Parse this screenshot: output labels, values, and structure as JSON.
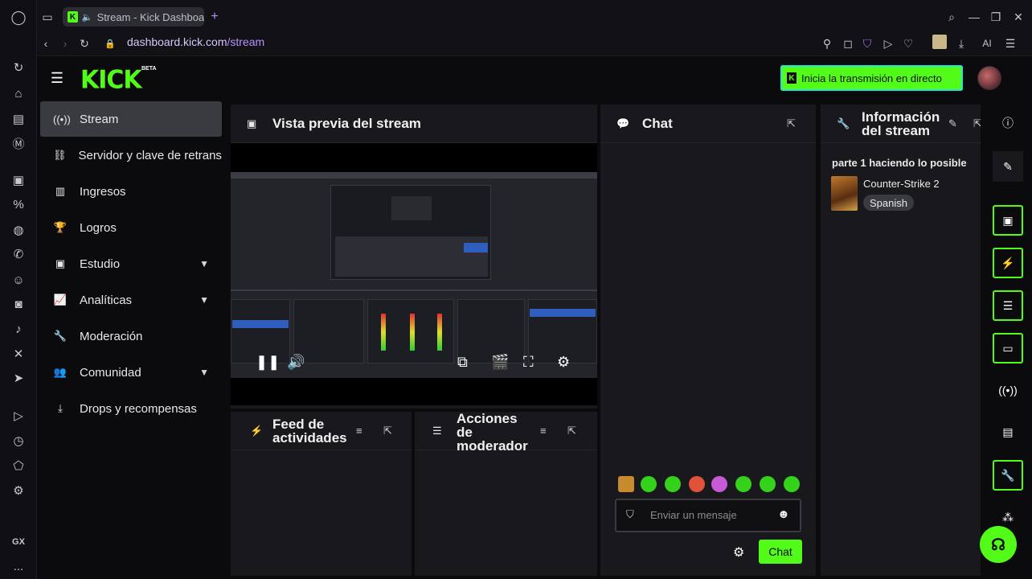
{
  "browser": {
    "tab_title": "Stream - Kick Dashboard",
    "tab_favicon": "K",
    "new_tab": "+",
    "url_host": "dashboard.kick.com",
    "url_path": "/stream",
    "ai_label": "AI",
    "sidebar_gx": "GX",
    "sidebar_more": "..."
  },
  "app": {
    "logo": "KICK",
    "logo_badge": "BETA",
    "go_live_label": "Inicia la transmisión en directo",
    "go_live_icon": "K"
  },
  "nav": {
    "items": [
      {
        "label": "Stream",
        "icon": "broadcast-icon",
        "active": true
      },
      {
        "label": "Servidor y clave de retransmisión",
        "icon": "link-icon"
      },
      {
        "label": "Ingresos",
        "icon": "chart-icon"
      },
      {
        "label": "Logros",
        "icon": "trophy-icon"
      },
      {
        "label": "Estudio",
        "icon": "studio-icon",
        "expandable": true
      },
      {
        "label": "Analíticas",
        "icon": "analytics-icon",
        "expandable": true
      },
      {
        "label": "Moderación",
        "icon": "wrench-icon"
      },
      {
        "label": "Comunidad",
        "icon": "community-icon",
        "expandable": true
      },
      {
        "label": "Drops y recompensas",
        "icon": "download-icon"
      }
    ]
  },
  "panels": {
    "preview_title": "Vista previa del stream",
    "chat_title": "Chat",
    "info_title_line1": "Información",
    "info_title_line2": "del stream",
    "feed_title_line1": "Feed de",
    "feed_title_line2": "actividades",
    "mod_title_line1": "Acciones",
    "mod_title_line2": "de",
    "mod_title_line3": "moderador"
  },
  "stream_info": {
    "title": "parte 1 haciendo lo posible",
    "game": "Counter-Strike 2",
    "language": "Spanish"
  },
  "chat": {
    "placeholder": "Enviar un mensaje",
    "send_label": "Chat"
  },
  "colors": {
    "accent": "#53fc18",
    "panel": "#19191d",
    "bg": "#0b0b0e",
    "url": "#b792ff"
  }
}
